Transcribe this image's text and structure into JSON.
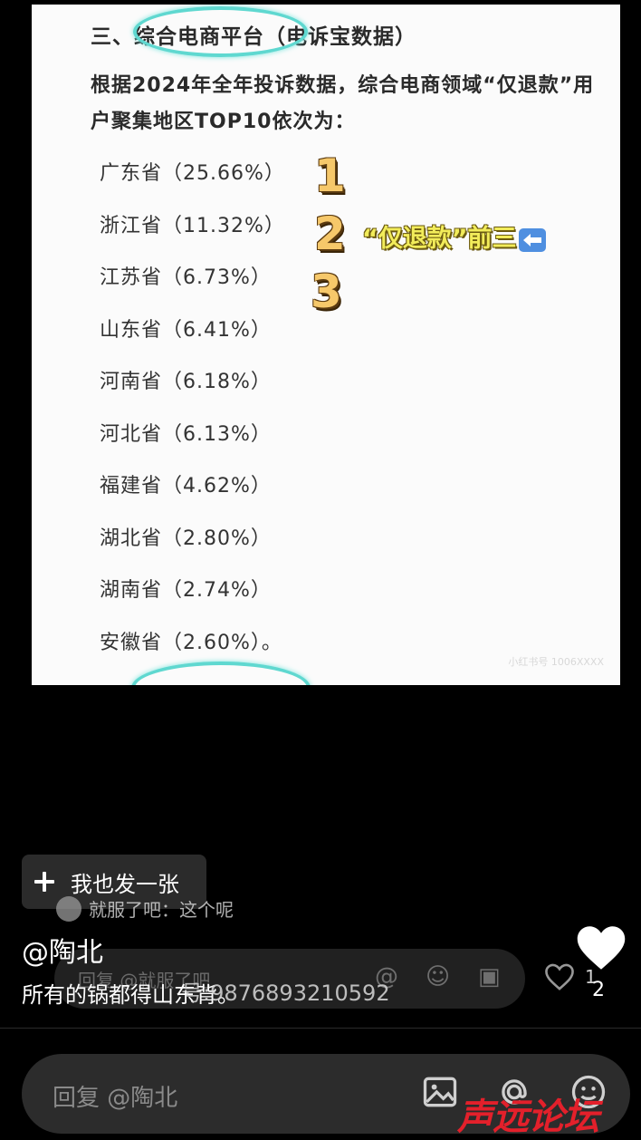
{
  "post_image": {
    "heading": "三、综合电商平台（电诉宝数据）",
    "intro": "根据2024年全年投诉数据，综合电商领域“仅退款”用户聚集地区TOP10依次为：",
    "provinces": [
      "广东省（25.66%）",
      "浙江省（11.32%）",
      "江苏省（6.73%）",
      "山东省（6.41%）",
      "河南省（6.18%）",
      "河北省（6.13%）",
      "福建省（4.62%）",
      "湖北省（2.80%）",
      "湖南省（2.74%）",
      "安徽省（2.60%）。"
    ],
    "rank_marks": [
      "1",
      "2",
      "3"
    ],
    "annotation": "“仅退款”前三",
    "faint_watermark": "小红书号 1006XXXX"
  },
  "post_chip": {
    "label": "我也发一张"
  },
  "danmaku": {
    "text": "就服了吧：这个呢"
  },
  "author": "@陶北",
  "caption": "所有的锅都得山东背。",
  "caption_overlay": "号:9876893210592",
  "ghost_reply": {
    "placeholder": "回复 @就服了吧",
    "like_count": "1"
  },
  "like_count": "2",
  "reply_bar": {
    "placeholder": "回复 @陶北"
  },
  "site_watermark": "声远论坛",
  "colors": {
    "background": "#000000",
    "highlight_ring": "#5fd8d0",
    "annotation": "#f2ec5a",
    "watermark": "#e3202b"
  }
}
